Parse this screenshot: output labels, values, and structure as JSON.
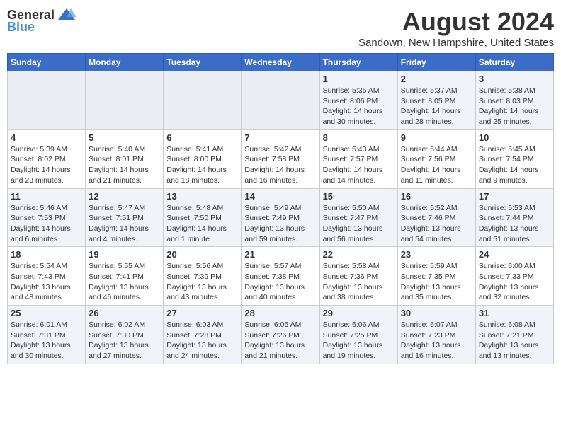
{
  "logo": {
    "general": "General",
    "blue": "Blue"
  },
  "title": {
    "month_year": "August 2024",
    "location": "Sandown, New Hampshire, United States"
  },
  "weekdays": [
    "Sunday",
    "Monday",
    "Tuesday",
    "Wednesday",
    "Thursday",
    "Friday",
    "Saturday"
  ],
  "weeks": [
    [
      {
        "day": "",
        "info": ""
      },
      {
        "day": "",
        "info": ""
      },
      {
        "day": "",
        "info": ""
      },
      {
        "day": "",
        "info": ""
      },
      {
        "day": "1",
        "info": "Sunrise: 5:35 AM\nSunset: 8:06 PM\nDaylight: 14 hours\nand 30 minutes."
      },
      {
        "day": "2",
        "info": "Sunrise: 5:37 AM\nSunset: 8:05 PM\nDaylight: 14 hours\nand 28 minutes."
      },
      {
        "day": "3",
        "info": "Sunrise: 5:38 AM\nSunset: 8:03 PM\nDaylight: 14 hours\nand 25 minutes."
      }
    ],
    [
      {
        "day": "4",
        "info": "Sunrise: 5:39 AM\nSunset: 8:02 PM\nDaylight: 14 hours\nand 23 minutes."
      },
      {
        "day": "5",
        "info": "Sunrise: 5:40 AM\nSunset: 8:01 PM\nDaylight: 14 hours\nand 21 minutes."
      },
      {
        "day": "6",
        "info": "Sunrise: 5:41 AM\nSunset: 8:00 PM\nDaylight: 14 hours\nand 18 minutes."
      },
      {
        "day": "7",
        "info": "Sunrise: 5:42 AM\nSunset: 7:58 PM\nDaylight: 14 hours\nand 16 minutes."
      },
      {
        "day": "8",
        "info": "Sunrise: 5:43 AM\nSunset: 7:57 PM\nDaylight: 14 hours\nand 14 minutes."
      },
      {
        "day": "9",
        "info": "Sunrise: 5:44 AM\nSunset: 7:56 PM\nDaylight: 14 hours\nand 11 minutes."
      },
      {
        "day": "10",
        "info": "Sunrise: 5:45 AM\nSunset: 7:54 PM\nDaylight: 14 hours\nand 9 minutes."
      }
    ],
    [
      {
        "day": "11",
        "info": "Sunrise: 5:46 AM\nSunset: 7:53 PM\nDaylight: 14 hours\nand 6 minutes."
      },
      {
        "day": "12",
        "info": "Sunrise: 5:47 AM\nSunset: 7:51 PM\nDaylight: 14 hours\nand 4 minutes."
      },
      {
        "day": "13",
        "info": "Sunrise: 5:48 AM\nSunset: 7:50 PM\nDaylight: 14 hours\nand 1 minute."
      },
      {
        "day": "14",
        "info": "Sunrise: 5:49 AM\nSunset: 7:49 PM\nDaylight: 13 hours\nand 59 minutes."
      },
      {
        "day": "15",
        "info": "Sunrise: 5:50 AM\nSunset: 7:47 PM\nDaylight: 13 hours\nand 56 minutes."
      },
      {
        "day": "16",
        "info": "Sunrise: 5:52 AM\nSunset: 7:46 PM\nDaylight: 13 hours\nand 54 minutes."
      },
      {
        "day": "17",
        "info": "Sunrise: 5:53 AM\nSunset: 7:44 PM\nDaylight: 13 hours\nand 51 minutes."
      }
    ],
    [
      {
        "day": "18",
        "info": "Sunrise: 5:54 AM\nSunset: 7:43 PM\nDaylight: 13 hours\nand 48 minutes."
      },
      {
        "day": "19",
        "info": "Sunrise: 5:55 AM\nSunset: 7:41 PM\nDaylight: 13 hours\nand 46 minutes."
      },
      {
        "day": "20",
        "info": "Sunrise: 5:56 AM\nSunset: 7:39 PM\nDaylight: 13 hours\nand 43 minutes."
      },
      {
        "day": "21",
        "info": "Sunrise: 5:57 AM\nSunset: 7:38 PM\nDaylight: 13 hours\nand 40 minutes."
      },
      {
        "day": "22",
        "info": "Sunrise: 5:58 AM\nSunset: 7:36 PM\nDaylight: 13 hours\nand 38 minutes."
      },
      {
        "day": "23",
        "info": "Sunrise: 5:59 AM\nSunset: 7:35 PM\nDaylight: 13 hours\nand 35 minutes."
      },
      {
        "day": "24",
        "info": "Sunrise: 6:00 AM\nSunset: 7:33 PM\nDaylight: 13 hours\nand 32 minutes."
      }
    ],
    [
      {
        "day": "25",
        "info": "Sunrise: 6:01 AM\nSunset: 7:31 PM\nDaylight: 13 hours\nand 30 minutes."
      },
      {
        "day": "26",
        "info": "Sunrise: 6:02 AM\nSunset: 7:30 PM\nDaylight: 13 hours\nand 27 minutes."
      },
      {
        "day": "27",
        "info": "Sunrise: 6:03 AM\nSunset: 7:28 PM\nDaylight: 13 hours\nand 24 minutes."
      },
      {
        "day": "28",
        "info": "Sunrise: 6:05 AM\nSunset: 7:26 PM\nDaylight: 13 hours\nand 21 minutes."
      },
      {
        "day": "29",
        "info": "Sunrise: 6:06 AM\nSunset: 7:25 PM\nDaylight: 13 hours\nand 19 minutes."
      },
      {
        "day": "30",
        "info": "Sunrise: 6:07 AM\nSunset: 7:23 PM\nDaylight: 13 hours\nand 16 minutes."
      },
      {
        "day": "31",
        "info": "Sunrise: 6:08 AM\nSunset: 7:21 PM\nDaylight: 13 hours\nand 13 minutes."
      }
    ]
  ]
}
